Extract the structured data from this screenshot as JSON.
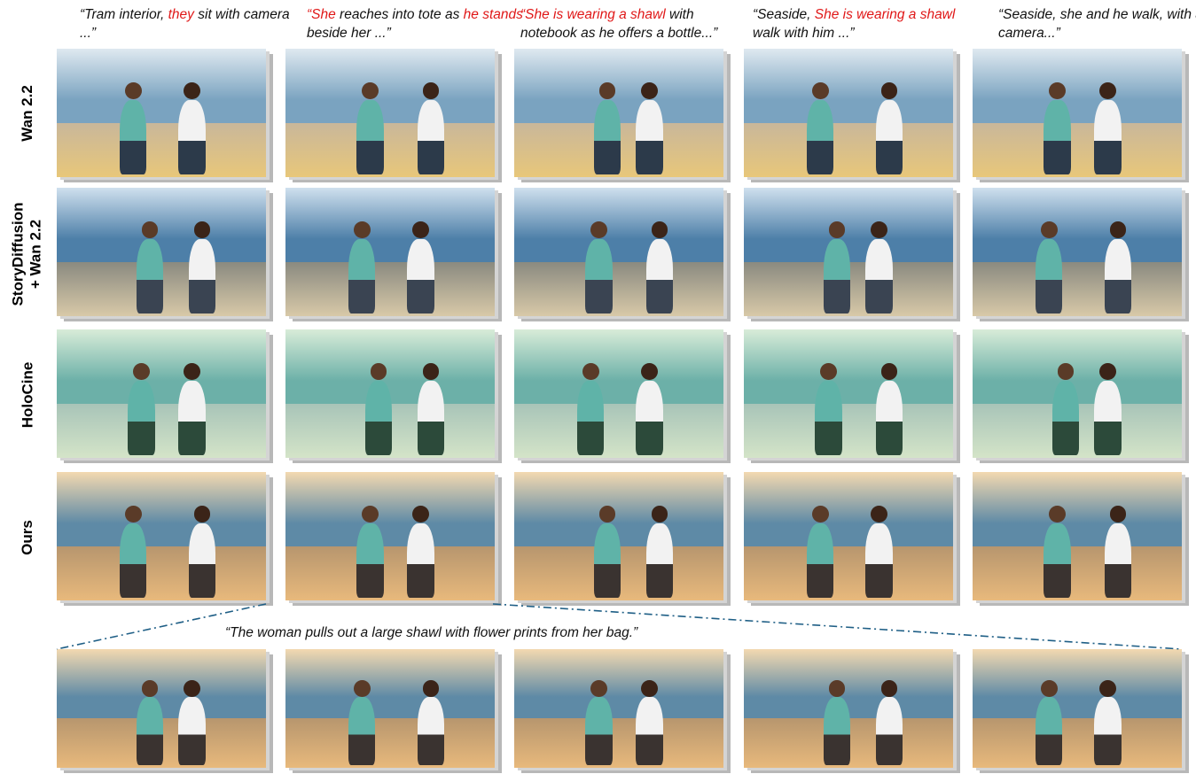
{
  "captions": [
    {
      "parts": [
        {
          "t": "“Tram interior, ",
          "red": false
        },
        {
          "t": "they",
          "red": true
        },
        {
          "t": " sit with camera ...”",
          "red": false
        }
      ]
    },
    {
      "parts": [
        {
          "t": "“She",
          "red": true
        },
        {
          "t": " reaches into tote as ",
          "red": false
        },
        {
          "t": "he stands",
          "red": true
        },
        {
          "t": " beside her ...”",
          "red": false
        }
      ]
    },
    {
      "parts": [
        {
          "t": "“She is wearing a shawl",
          "red": true
        },
        {
          "t": " with notebook as he offers a bottle...”",
          "red": false
        }
      ]
    },
    {
      "parts": [
        {
          "t": "“Seaside, ",
          "red": false
        },
        {
          "t": "She is wearing a shawl",
          "red": true
        },
        {
          "t": " walk with him ...”",
          "red": false
        }
      ]
    },
    {
      "parts": [
        {
          "t": "“Seaside, she and he walk, with a camera...”",
          "red": false
        }
      ]
    }
  ],
  "row_labels": [
    "Wan 2.2",
    "StoryDiffusion\n+ Wan 2.2",
    "HoloCine",
    "Ours"
  ],
  "bottom_caption": "“The woman pulls out a large shawl with flower prints from her bag.”",
  "colors": {
    "highlight": "#e01818",
    "guide_line": "#1f5f86"
  }
}
